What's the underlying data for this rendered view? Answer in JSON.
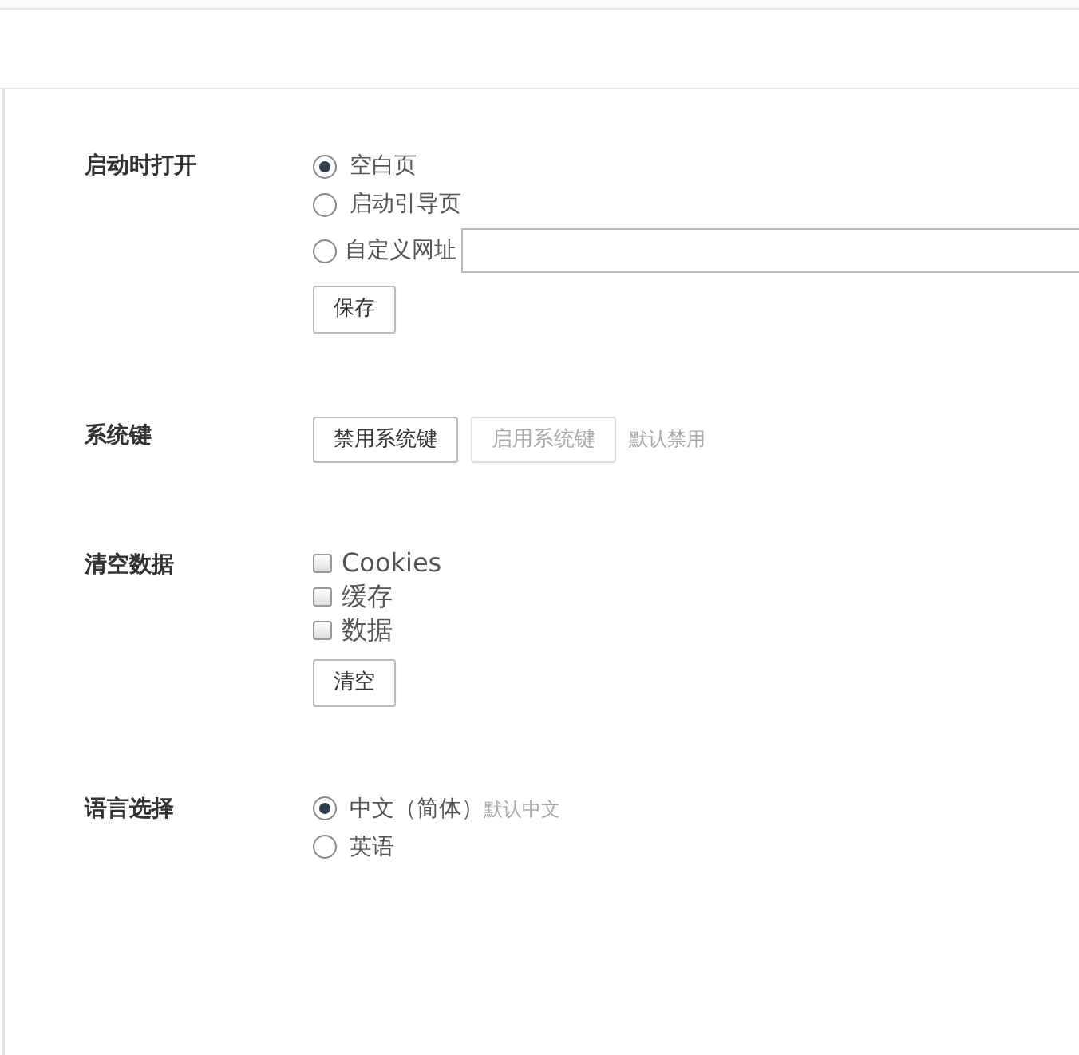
{
  "sections": [
    {
      "label": "启动时打开",
      "items": [
        {
          "kind": "radio",
          "label": "空白页",
          "selected": true
        },
        {
          "kind": "radio",
          "label": "启动引导页",
          "selected": false
        },
        {
          "kind": "radio-field",
          "label": "自定义网址",
          "selected": false
        },
        {
          "kind": "button",
          "label": "保存",
          "disabled": false
        }
      ]
    },
    {
      "label": "系统键",
      "items": [
        {
          "kind": "button-row",
          "buttons": [
            {
              "label": "禁用系统键",
              "disabled": false
            },
            {
              "label": "启用系统键",
              "disabled": true
            }
          ],
          "note": "默认禁用"
        }
      ]
    },
    {
      "label": "清空数据",
      "items": [
        {
          "kind": "checkbox",
          "label": "Cookies",
          "checked": false
        },
        {
          "kind": "checkbox",
          "label": "缓存",
          "checked": false
        },
        {
          "kind": "checkbox",
          "label": "数据",
          "checked": false
        },
        {
          "kind": "button",
          "label": "清空",
          "disabled": false
        }
      ]
    },
    {
      "label": "语言选择",
      "items": [
        {
          "kind": "radio",
          "label": "中文（简体）",
          "selected": true,
          "note": "默认中文"
        },
        {
          "kind": "radio",
          "label": "英语",
          "selected": false
        }
      ]
    }
  ]
}
